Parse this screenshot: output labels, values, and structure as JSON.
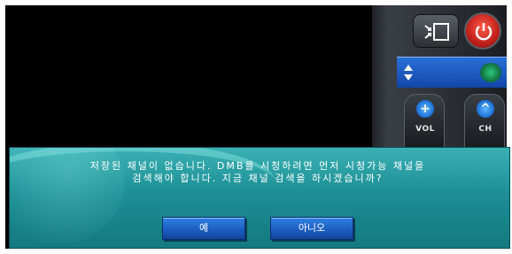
{
  "dialog": {
    "message_line1": "저장된 채널이 없습니다. DMB를 시청하려면 먼저 시청가능 채널을",
    "message_line2": "검색해야 합니다. 지금 채널 검색을 하시겠습니까?",
    "yes_label": "예",
    "no_label": "아니오"
  },
  "controls": {
    "vol_label": "VOL",
    "ch_label": "CH",
    "vol_up_symbol": "+",
    "ch_up_symbol": "^",
    "icons": [
      "pip-icon",
      "power-icon",
      "channel-updown-icon"
    ]
  },
  "colors": {
    "dialog_bg": "#1c8f95",
    "button_bg": "#1c5ec2",
    "power": "#c0201a",
    "channel_bar": "#1246a8"
  }
}
